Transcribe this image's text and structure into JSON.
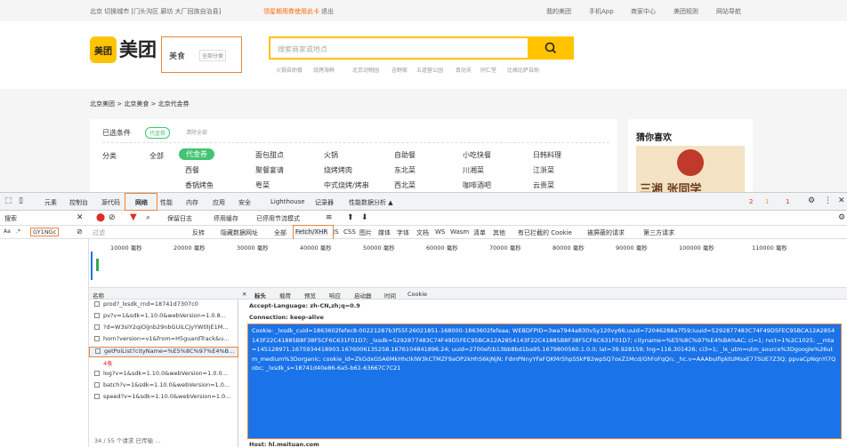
{
  "topbar": {
    "location": "北京 切换城市 [门头沟区 廊坊 大厂回族自治县]",
    "promo": "领星期用券使用此卡",
    "logout": "退出",
    "links": [
      "我的美团",
      "手机App",
      "商家中心",
      "美团规则",
      "网站导航"
    ]
  },
  "header": {
    "logo_icon": "美团",
    "logo_text": "美团",
    "city": "美食",
    "city_dropdown": "全部分类",
    "search_placeholder": "搜索商家或地点",
    "hot_words": [
      "火锅自助餐",
      "烧烤海鲜",
      "北京动物园",
      "吉野家",
      "五道营公园",
      "真功夫",
      "同仁堂",
      "比格比萨自助"
    ]
  },
  "content": {
    "breadcrumb": "北京美团 > 北京美食 > 北京代金券",
    "filter_label": "已选条件",
    "filter_tag": "代金券",
    "clear": "清除全部",
    "category_label": "分类",
    "cat_all": "全部",
    "cat_tag": "代金券",
    "cats": [
      [
        "西餐",
        "面包甜点",
        "火锅",
        "自助餐",
        "小吃快餐",
        "日韩料理"
      ],
      [
        "西餐",
        "聚餐宴请",
        "烧烤烤肉",
        "东北菜",
        "川湘菜",
        "江浙菜"
      ],
      [
        "香锅烤鱼",
        "粤菜",
        "中式烧烤/烤串",
        "西北菜",
        "咖啡酒吧",
        "云贵菜"
      ]
    ],
    "side_title": "猜你喜欢",
    "side_img_text": "三湘 张同学"
  },
  "devtools": {
    "tabs": [
      "元素",
      "控制台",
      "源代码",
      "网络",
      "性能",
      "内存",
      "应用",
      "安全",
      "Lighthouse",
      "记录器",
      "性能数据分析 ▲"
    ],
    "badges": [
      "2",
      "1",
      "1"
    ],
    "search_tab": "搜索",
    "row2_items": [
      "保留日志",
      "停用缓存",
      "已停用节流模式"
    ],
    "search_value": "GY1NGc",
    "filter_placeholder": "过滤",
    "filter_options": [
      "反转",
      "隐藏数据网址",
      "全部",
      "Fetch/XHR",
      "JS",
      "CSS",
      "图片",
      "媒体",
      "字体",
      "文档",
      "WS",
      "Wasm",
      "清单",
      "其他",
      "有已拦截的 Cookie",
      "被屏蔽的请求",
      "第三方请求"
    ],
    "timeline": [
      "10000 毫秒",
      "20000 毫秒",
      "30000 毫秒",
      "40000 毫秒",
      "50000 毫秒",
      "60000 毫秒",
      "70000 毫秒",
      "80000 毫秒",
      "90000 毫秒",
      "100000 毫秒",
      "110000 毫秒"
    ],
    "name_header": "名称",
    "requests": [
      "prod?_lxsdk_rnd=18741d7307c0",
      "pv?v=1&sdk=1.10.0&webVersion=1.0.8...",
      "?d=W3sIY2qiOiJnb29nbGUiLCJyYWtlIjE1M...",
      "horn?version=v1&from=H5guardTrack&u...",
      "getPoiList?cityName=%E5%8C%97%E4%B...",
      "4条",
      "log?v=1&sdk=1.10.0&webVersion=1.0.0...",
      "batch?v=1&sdk=1.10.0&webVersion=1.0...",
      "speed?v=1&sdk=1.10.0&webVersion=1.0..."
    ],
    "status": "34 / 55 个请求 已传输 ...",
    "detail_tabs": [
      "标头",
      "载荷",
      "预览",
      "响应",
      "启动器",
      "时间",
      "Cookie"
    ],
    "accept_language": "Accept-Language: zh-CN,zh;q=0.9",
    "connection": "Connection: keep-alive",
    "cookie": "Cookie: _lxsdk_cuid=1863602fefec8-00221287b3f55f-26021851-168000-1863602fefeaa; WEBDFPID=3wa7944a830v5y120vy66;uuid=72046288a7f59;iuuid=5292877483C74F49D5FEC95BCA12A2854143F22C41885B8F38F5CF6C631F01D7; _lxsdk=5292877483C74F49D5FEC95BCA12A2854143F22C41885B8F38F5CF6C631F01D7; cityname=%E5%8C%97%E4%BA%AC; ci=1; rvct=1%2C1025; __mta=145128971.1675934418903.1676006135258.1676104841896.24; uuid=2700efcb13bb8bd1ba95.1679800560.1.0.0; lat=39.928159; lng=116.301426; ci3=1; _lx_utm=utm_source%3Dgoogle%26utm_medium%3Dorganic; cookie_id=ZkGdxGSA6MkHhcIklW3kCTMZF9aOP2kHhS6kjNjN; FdmPNnyYFaFQKMr5hpSSkPB2wpSQ7oxZ1Mcd/GhFoFqQn; _hc.v=AAAbuIfipktUMsxE77SUE7Z3Q; ppvaCpNqnYI7Qobc; _lxsdk_s=18741d40e86-6a5-b61-63667C7C21",
    "host": "Host: hl.meituan.com"
  }
}
